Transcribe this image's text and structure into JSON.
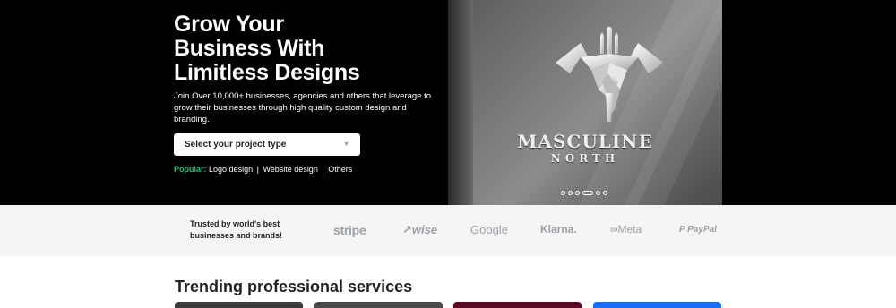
{
  "hero": {
    "title_line1": "Grow Your",
    "title_line2": "Business With",
    "title_line3": "Limitless Designs",
    "description": "Join Over 10,000+ businesses, agencies and others that leverage to grow their businesses through high quality custom design and branding.",
    "select_placeholder": "Select your project type",
    "popular_label": "Popular:",
    "popular_links": [
      "Logo design",
      "Website design",
      "Others"
    ],
    "sep": "|",
    "image_brand_line1": "MASCULINE",
    "image_brand_line2": "NORTH",
    "carousel_dots": 6,
    "carousel_active_index": 3
  },
  "trusted": {
    "text": "Trusted by world's best businesses and brands!",
    "brands": [
      "stripe",
      "↗wise",
      "Google",
      "Klarna.",
      "∞Meta",
      "P PayPal"
    ]
  },
  "trending": {
    "title": "Trending professional services"
  },
  "colors": {
    "accent_green": "#1dbf73",
    "hero_bg": "#000000",
    "trusted_bg": "#f5f5f5",
    "card_colors": [
      "#3a3a3a",
      "#4a4a4a",
      "#5c0a28",
      "#1a6dff"
    ]
  }
}
